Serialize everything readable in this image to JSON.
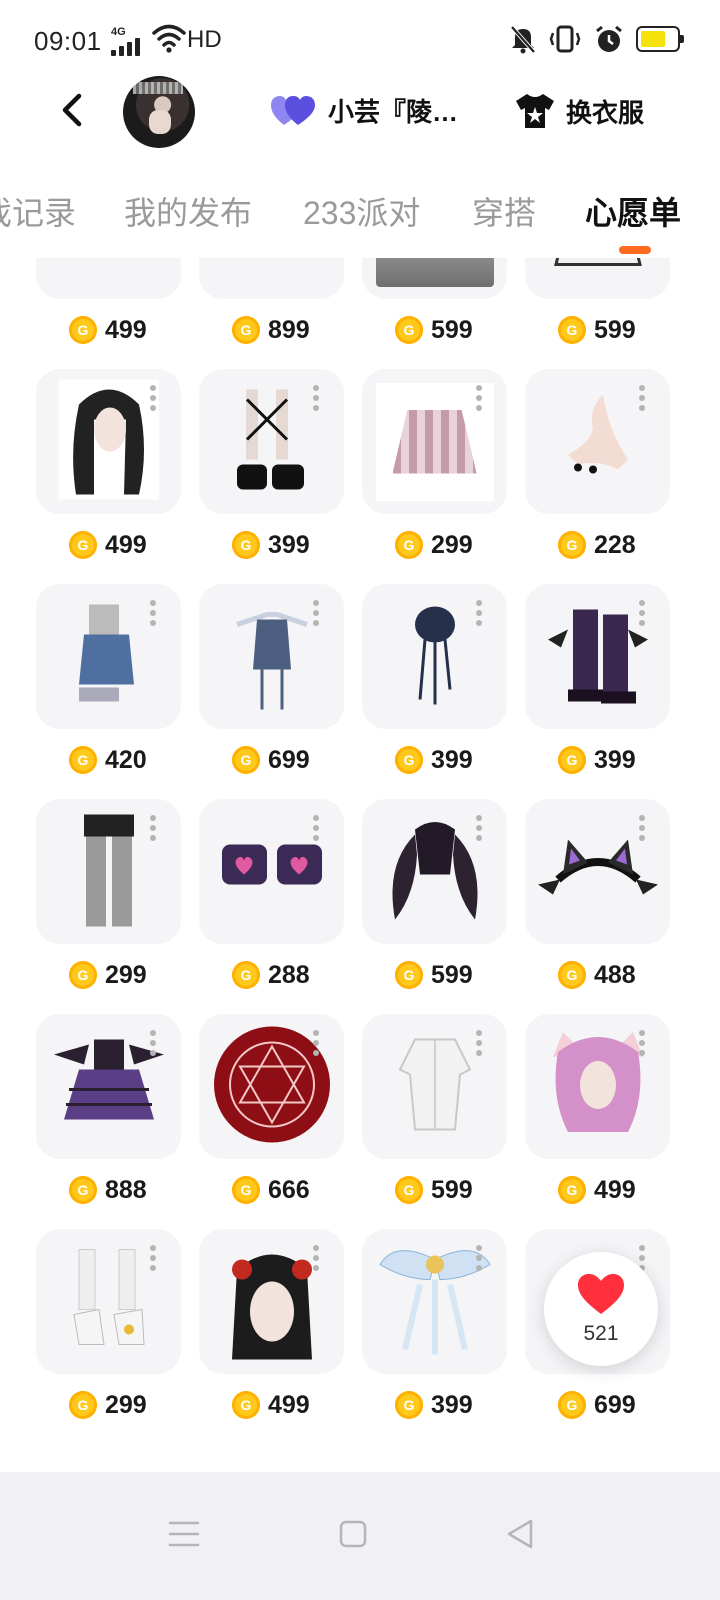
{
  "status": {
    "time": "09:01",
    "network_tag": "4G",
    "hd": "HD",
    "battery_color": "#f5e20b"
  },
  "header": {
    "friend_name": "小芸『陵…",
    "outfit_label": "换衣服",
    "heart_color": "#6b5ce7"
  },
  "tabs": [
    {
      "label": "游戏记录"
    },
    {
      "label": "我的发布"
    },
    {
      "label": "233派对"
    },
    {
      "label": "穿搭"
    },
    {
      "label": "心愿单",
      "active": true
    }
  ],
  "accent_color": "#ff6a1f",
  "items": [
    {
      "price": "499",
      "icon": "headpiece-horns"
    },
    {
      "price": "899",
      "icon": "black-hair"
    },
    {
      "price": "599",
      "icon": "glass-stand"
    },
    {
      "price": "599",
      "icon": "frilly-dress"
    },
    {
      "price": "499",
      "icon": "black-long-hair"
    },
    {
      "price": "399",
      "icon": "lace-up-boots"
    },
    {
      "price": "299",
      "icon": "plaid-skirt"
    },
    {
      "price": "228",
      "icon": "nail-hand"
    },
    {
      "price": "420",
      "icon": "denim-shorts"
    },
    {
      "price": "699",
      "icon": "blue-corset-dress"
    },
    {
      "price": "399",
      "icon": "navy-hat"
    },
    {
      "price": "399",
      "icon": "purple-boots"
    },
    {
      "price": "299",
      "icon": "black-shorts-stockings"
    },
    {
      "price": "288",
      "icon": "heart-arm-cuffs"
    },
    {
      "price": "599",
      "icon": "twin-tail-hair"
    },
    {
      "price": "488",
      "icon": "cat-ear-headband"
    },
    {
      "price": "888",
      "icon": "gothic-bat-dress"
    },
    {
      "price": "666",
      "icon": "red-magic-circle"
    },
    {
      "price": "599",
      "icon": "white-coat"
    },
    {
      "price": "499",
      "icon": "purple-cat-hair"
    },
    {
      "price": "299",
      "icon": "white-heels"
    },
    {
      "price": "499",
      "icon": "ornate-hair"
    },
    {
      "price": "399",
      "icon": "angel-wings"
    },
    {
      "price": "699",
      "icon": "red-white-skirt"
    }
  ],
  "wishlist": {
    "count": "521",
    "heart_color": "#ff2f3c"
  }
}
